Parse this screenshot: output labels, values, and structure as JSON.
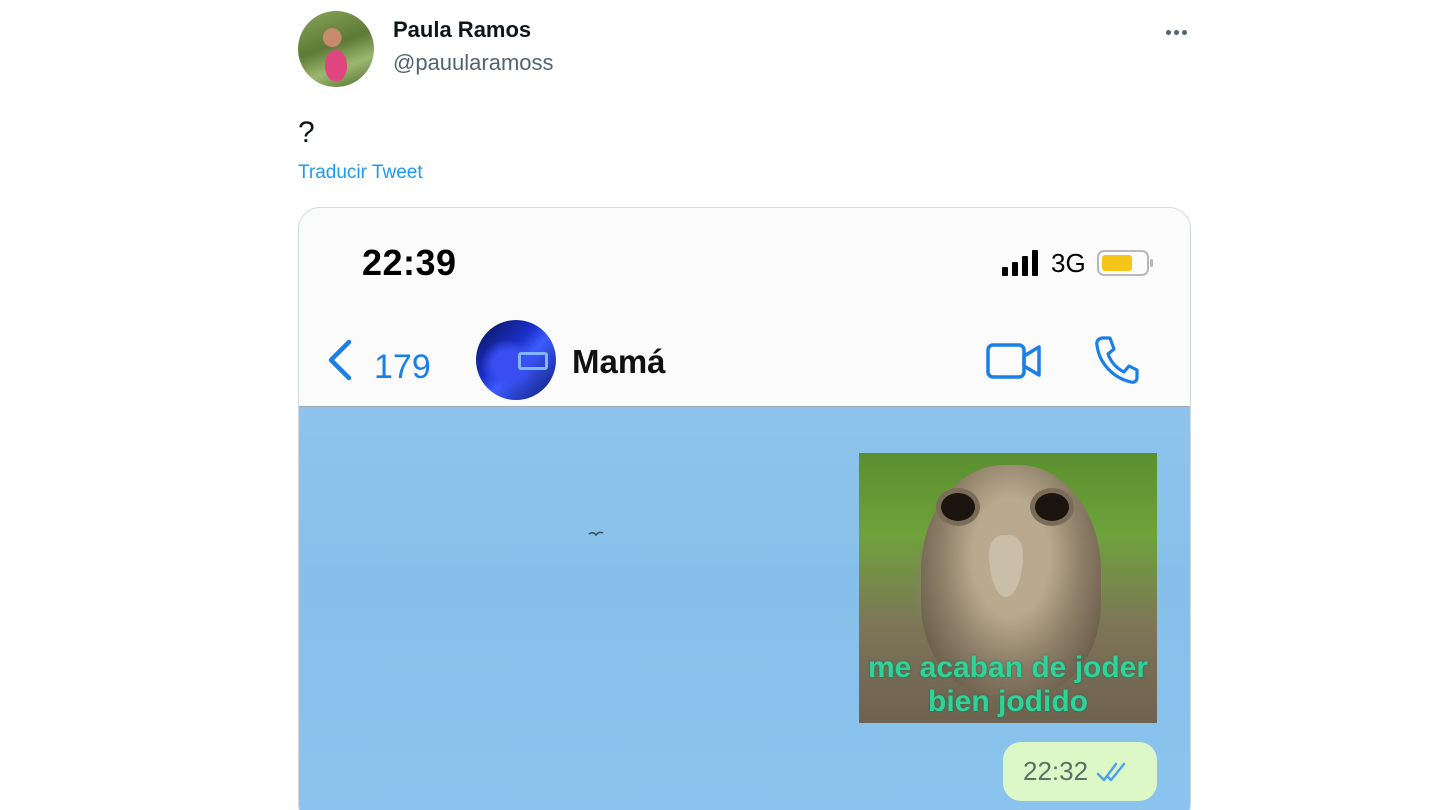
{
  "tweet": {
    "author_name": "Paula Ramos",
    "author_handle": "@pauularamoss",
    "text": "?",
    "translate_label": "Traducir Tweet"
  },
  "screenshot": {
    "status_bar": {
      "time": "22:39",
      "network": "3G",
      "icons": [
        "signal-bars-icon",
        "battery-icon"
      ],
      "battery_color": "#f5c518"
    },
    "chat_header": {
      "back_count": "179",
      "contact_name": "Mamá",
      "icons": [
        "chevron-left-icon",
        "video-call-icon",
        "phone-icon"
      ],
      "accent_color": "#1a7fe6"
    },
    "messages": [
      {
        "type": "image",
        "caption": "me acaban de joder bien jodido"
      },
      {
        "type": "timestamp",
        "time": "22:32",
        "status_icon": "double-check-icon"
      }
    ]
  }
}
